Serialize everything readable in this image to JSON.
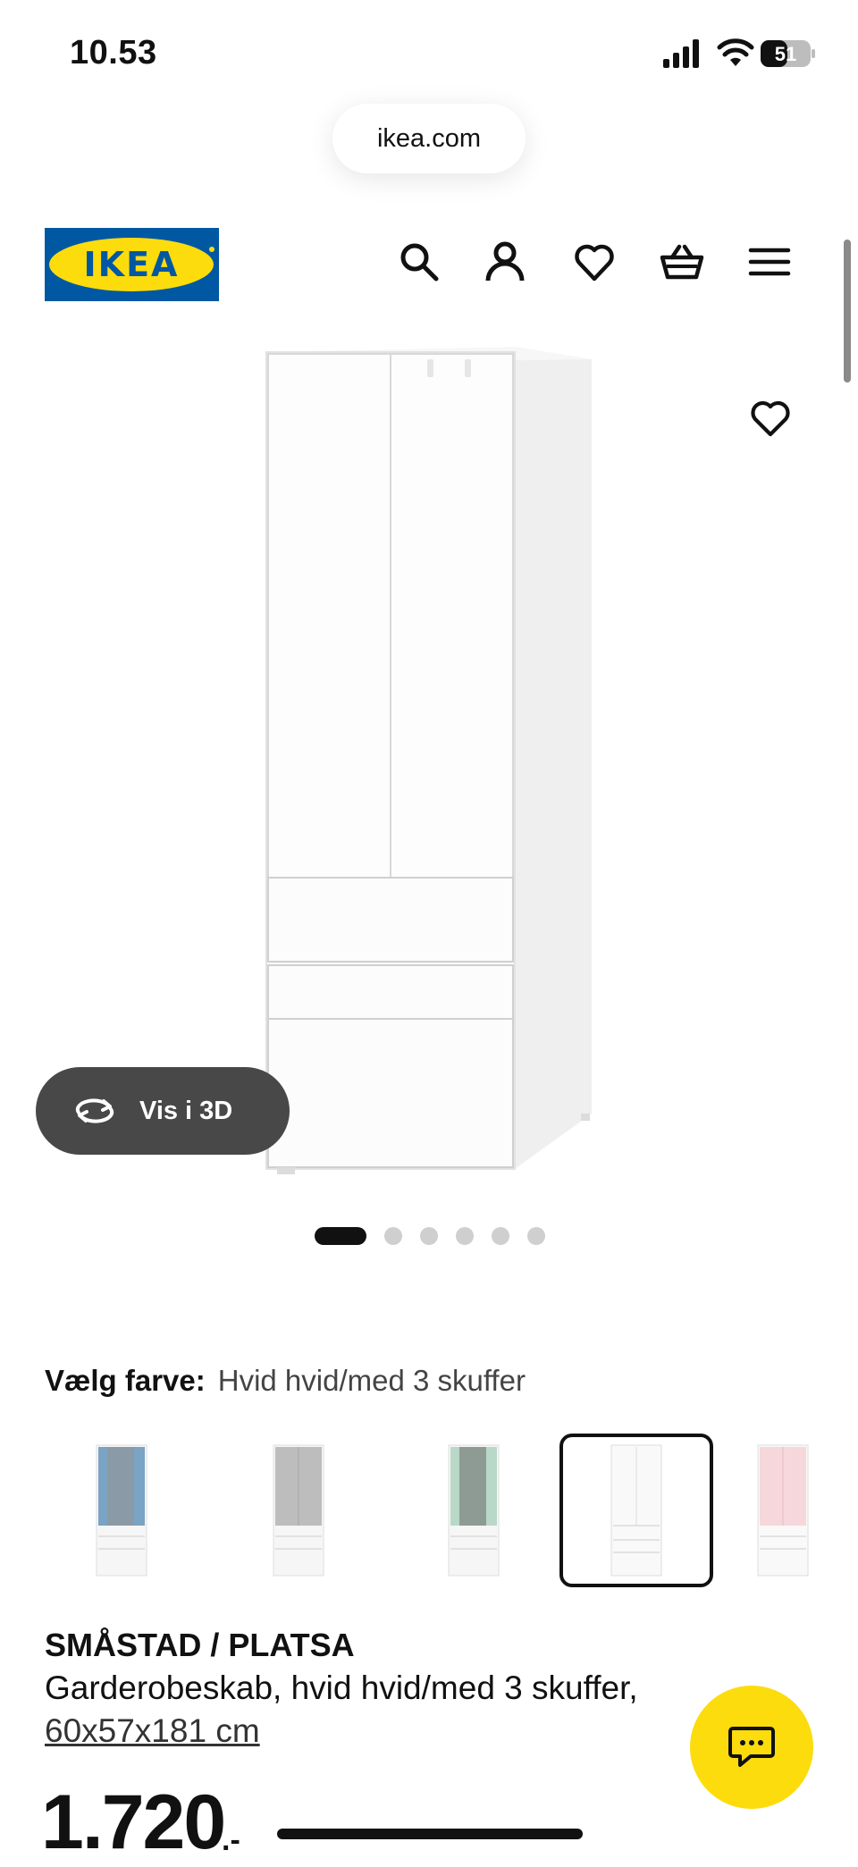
{
  "status_bar": {
    "time": "10.53",
    "battery": "51"
  },
  "browser": {
    "url": "ikea.com"
  },
  "header": {
    "logo_text": "IKEA",
    "icons": [
      "search-icon",
      "profile-icon",
      "heart-icon",
      "basket-icon",
      "menu-icon"
    ]
  },
  "gallery": {
    "view_3d_label": "Vis i 3D",
    "image_count": 6,
    "active_index": 0
  },
  "colour": {
    "label": "Vælg farve:",
    "value": "Hvid hvid/med 3 skuffer",
    "options": [
      {
        "name": "blue",
        "door": "#7aa3c4"
      },
      {
        "name": "grey",
        "door": "#bdbdbd"
      },
      {
        "name": "mint",
        "door": "#b9d8c8"
      },
      {
        "name": "white",
        "door": "#f3f3f3",
        "selected": true
      },
      {
        "name": "pink",
        "door": "#f6d7dc"
      }
    ]
  },
  "product": {
    "name": "SMÅSTAD / PLATSA",
    "description": "Garderobeskab, hvid hvid/med 3 skuffer,",
    "dimensions": "60x57x181 cm",
    "price": "1.720",
    "price_suffix": ".-"
  },
  "colors": {
    "brand_blue": "#0058a3",
    "brand_yellow": "#fcdc0c",
    "dark_button": "#484848"
  }
}
